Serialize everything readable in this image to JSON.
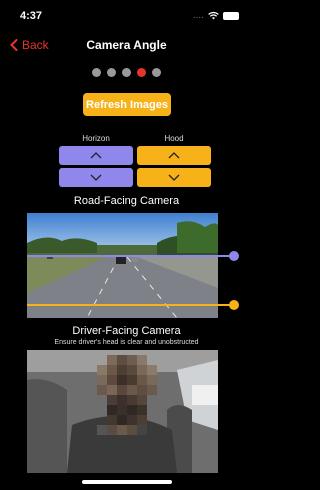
{
  "status": {
    "time": "4:37",
    "signal": "....",
    "wifi_icon": "wifi-icon",
    "battery_icon": "battery-icon"
  },
  "nav": {
    "back_label": "Back",
    "title": "Camera Angle"
  },
  "pager": {
    "count": 5,
    "active_index": 3
  },
  "refresh_label": "Refresh Images",
  "adjust": {
    "horizon_label": "Horizon",
    "hood_label": "Hood"
  },
  "road_camera": {
    "title": "Road-Facing Camera"
  },
  "driver_camera": {
    "title": "Driver-Facing Camera",
    "subtitle": "Ensure driver's head is clear and unobstructed"
  },
  "colors": {
    "accent_red": "#e8352b",
    "yellow": "#f7b21a",
    "purple": "#8f87ec"
  }
}
